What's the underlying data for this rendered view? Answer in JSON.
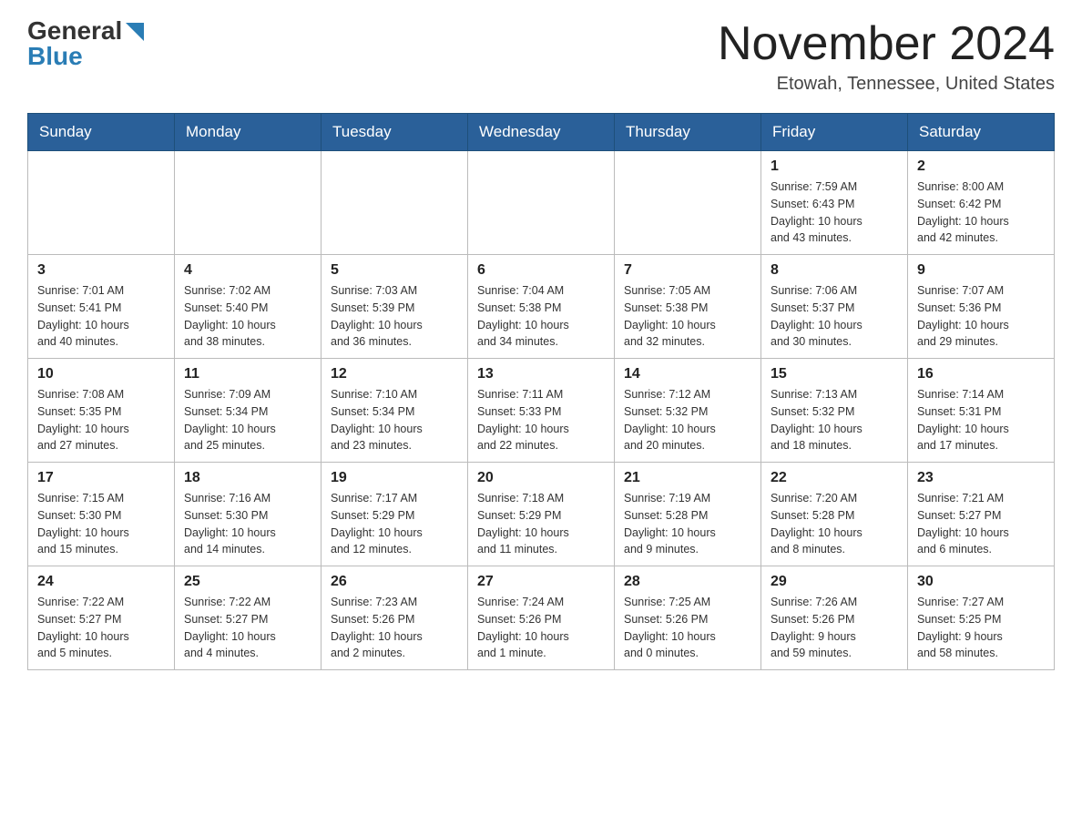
{
  "header": {
    "logo_general": "General",
    "logo_blue": "Blue",
    "month_title": "November 2024",
    "location": "Etowah, Tennessee, United States"
  },
  "weekdays": [
    "Sunday",
    "Monday",
    "Tuesday",
    "Wednesday",
    "Thursday",
    "Friday",
    "Saturday"
  ],
  "weeks": [
    [
      {
        "day": "",
        "info": ""
      },
      {
        "day": "",
        "info": ""
      },
      {
        "day": "",
        "info": ""
      },
      {
        "day": "",
        "info": ""
      },
      {
        "day": "",
        "info": ""
      },
      {
        "day": "1",
        "info": "Sunrise: 7:59 AM\nSunset: 6:43 PM\nDaylight: 10 hours\nand 43 minutes."
      },
      {
        "day": "2",
        "info": "Sunrise: 8:00 AM\nSunset: 6:42 PM\nDaylight: 10 hours\nand 42 minutes."
      }
    ],
    [
      {
        "day": "3",
        "info": "Sunrise: 7:01 AM\nSunset: 5:41 PM\nDaylight: 10 hours\nand 40 minutes."
      },
      {
        "day": "4",
        "info": "Sunrise: 7:02 AM\nSunset: 5:40 PM\nDaylight: 10 hours\nand 38 minutes."
      },
      {
        "day": "5",
        "info": "Sunrise: 7:03 AM\nSunset: 5:39 PM\nDaylight: 10 hours\nand 36 minutes."
      },
      {
        "day": "6",
        "info": "Sunrise: 7:04 AM\nSunset: 5:38 PM\nDaylight: 10 hours\nand 34 minutes."
      },
      {
        "day": "7",
        "info": "Sunrise: 7:05 AM\nSunset: 5:38 PM\nDaylight: 10 hours\nand 32 minutes."
      },
      {
        "day": "8",
        "info": "Sunrise: 7:06 AM\nSunset: 5:37 PM\nDaylight: 10 hours\nand 30 minutes."
      },
      {
        "day": "9",
        "info": "Sunrise: 7:07 AM\nSunset: 5:36 PM\nDaylight: 10 hours\nand 29 minutes."
      }
    ],
    [
      {
        "day": "10",
        "info": "Sunrise: 7:08 AM\nSunset: 5:35 PM\nDaylight: 10 hours\nand 27 minutes."
      },
      {
        "day": "11",
        "info": "Sunrise: 7:09 AM\nSunset: 5:34 PM\nDaylight: 10 hours\nand 25 minutes."
      },
      {
        "day": "12",
        "info": "Sunrise: 7:10 AM\nSunset: 5:34 PM\nDaylight: 10 hours\nand 23 minutes."
      },
      {
        "day": "13",
        "info": "Sunrise: 7:11 AM\nSunset: 5:33 PM\nDaylight: 10 hours\nand 22 minutes."
      },
      {
        "day": "14",
        "info": "Sunrise: 7:12 AM\nSunset: 5:32 PM\nDaylight: 10 hours\nand 20 minutes."
      },
      {
        "day": "15",
        "info": "Sunrise: 7:13 AM\nSunset: 5:32 PM\nDaylight: 10 hours\nand 18 minutes."
      },
      {
        "day": "16",
        "info": "Sunrise: 7:14 AM\nSunset: 5:31 PM\nDaylight: 10 hours\nand 17 minutes."
      }
    ],
    [
      {
        "day": "17",
        "info": "Sunrise: 7:15 AM\nSunset: 5:30 PM\nDaylight: 10 hours\nand 15 minutes."
      },
      {
        "day": "18",
        "info": "Sunrise: 7:16 AM\nSunset: 5:30 PM\nDaylight: 10 hours\nand 14 minutes."
      },
      {
        "day": "19",
        "info": "Sunrise: 7:17 AM\nSunset: 5:29 PM\nDaylight: 10 hours\nand 12 minutes."
      },
      {
        "day": "20",
        "info": "Sunrise: 7:18 AM\nSunset: 5:29 PM\nDaylight: 10 hours\nand 11 minutes."
      },
      {
        "day": "21",
        "info": "Sunrise: 7:19 AM\nSunset: 5:28 PM\nDaylight: 10 hours\nand 9 minutes."
      },
      {
        "day": "22",
        "info": "Sunrise: 7:20 AM\nSunset: 5:28 PM\nDaylight: 10 hours\nand 8 minutes."
      },
      {
        "day": "23",
        "info": "Sunrise: 7:21 AM\nSunset: 5:27 PM\nDaylight: 10 hours\nand 6 minutes."
      }
    ],
    [
      {
        "day": "24",
        "info": "Sunrise: 7:22 AM\nSunset: 5:27 PM\nDaylight: 10 hours\nand 5 minutes."
      },
      {
        "day": "25",
        "info": "Sunrise: 7:22 AM\nSunset: 5:27 PM\nDaylight: 10 hours\nand 4 minutes."
      },
      {
        "day": "26",
        "info": "Sunrise: 7:23 AM\nSunset: 5:26 PM\nDaylight: 10 hours\nand 2 minutes."
      },
      {
        "day": "27",
        "info": "Sunrise: 7:24 AM\nSunset: 5:26 PM\nDaylight: 10 hours\nand 1 minute."
      },
      {
        "day": "28",
        "info": "Sunrise: 7:25 AM\nSunset: 5:26 PM\nDaylight: 10 hours\nand 0 minutes."
      },
      {
        "day": "29",
        "info": "Sunrise: 7:26 AM\nSunset: 5:26 PM\nDaylight: 9 hours\nand 59 minutes."
      },
      {
        "day": "30",
        "info": "Sunrise: 7:27 AM\nSunset: 5:25 PM\nDaylight: 9 hours\nand 58 minutes."
      }
    ]
  ]
}
